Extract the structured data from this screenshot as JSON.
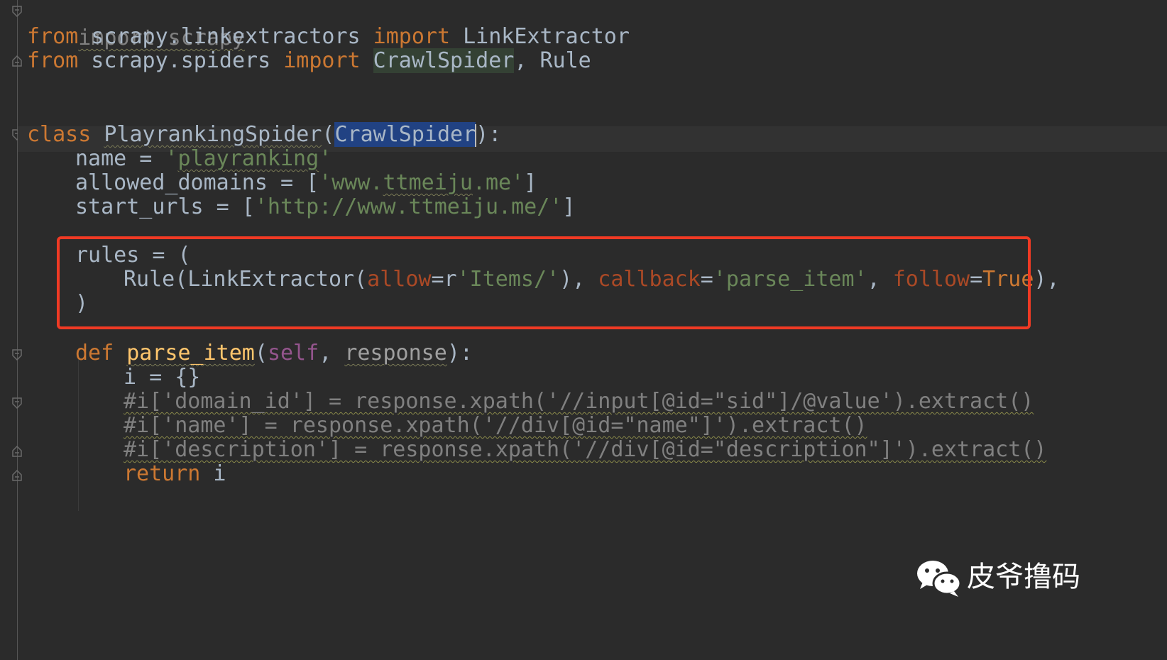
{
  "editor": {
    "lines": {
      "l1": {
        "a": "import scrapy"
      },
      "l2": {
        "kw1": "from",
        "mod": " scrapy.linkextractors ",
        "kw2": "import",
        "name": " LinkExtractor"
      },
      "l3": {
        "kw1": "from",
        "mod": " scrapy.spiders ",
        "kw2": "import",
        "sp": " ",
        "cls": "CrawlSpider",
        "rest": ", Rule"
      },
      "l4": {
        "kw": "class",
        "sp": " ",
        "name": "PlayrankingSpider",
        "open": "(",
        "base": "CrawlSpider",
        "close": "):"
      },
      "l5": {
        "lhs": "name = ",
        "q1": "'",
        "val": "playranking",
        "q2": "'"
      },
      "l6": {
        "lhs": "allowed_domains = [",
        "s1": "'www.",
        "s2": "ttmeiju",
        "s3": ".me'",
        "end": "]"
      },
      "l7": {
        "lhs": "start_urls = [",
        "s": "'http://www.ttmeiju.me/'",
        "end": "]"
      },
      "l8": {
        "a": "rules = ("
      },
      "l9": {
        "a": "Rule(LinkExtractor(",
        "p1": "allow",
        "eq1": "=r",
        "s1": "'Items/'",
        "b": "), ",
        "p2": "callback",
        "eq2": "=",
        "s2": "'parse_item'",
        "c": ", ",
        "p3": "follow",
        "eq3": "=",
        "t": "True",
        "d": "),"
      },
      "l10": {
        "a": ")"
      },
      "l11": {
        "kw": "def",
        "sp": " ",
        "fn": "parse_item",
        "open": "(",
        "self": "self",
        "comma": ", ",
        "arg": "response",
        "close": "):"
      },
      "l12": {
        "a": "i = {}"
      },
      "l13": {
        "a": "#i['domain_id'] = response.xpath('//input[@id=\"sid\"]/@value').extract()"
      },
      "l14": {
        "a": "#i['name'] = response.xpath('//div[@id=\"name\"]').extract()"
      },
      "l15": {
        "a": "#i['description'] = response.xpath('//div[@id=\"description\"]').extract()"
      },
      "l16": {
        "kw": "return",
        "rest": " i"
      }
    }
  },
  "watermark": {
    "logo_icon": "wechat-icon",
    "text": "皮爷撸码"
  },
  "colors": {
    "background": "#2b2b2b",
    "keyword": "#cc7832",
    "string": "#6a8759",
    "comment": "#808080",
    "highlight_box": "#f03a24"
  }
}
